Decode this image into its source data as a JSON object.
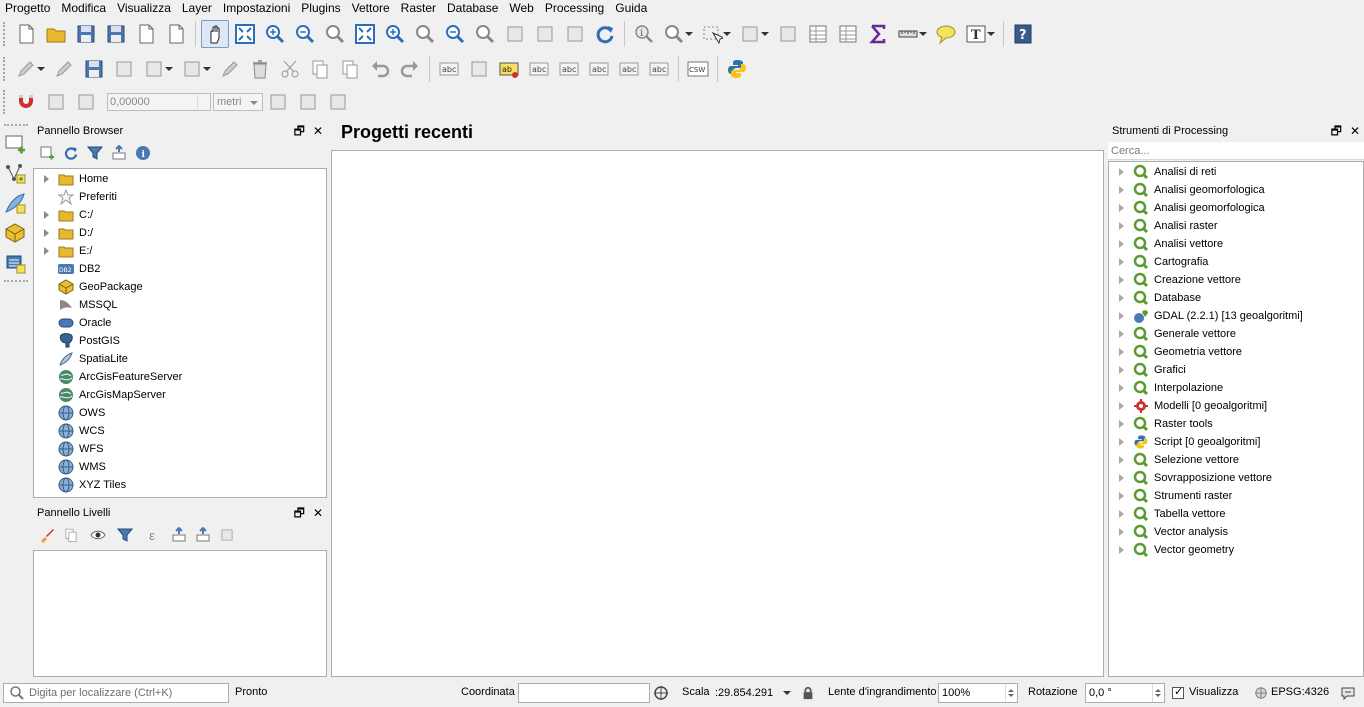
{
  "menu": [
    "Progetto",
    "Modifica",
    "Visualizza",
    "Layer",
    "Impostazioni",
    "Plugins",
    "Vettore",
    "Raster",
    "Database",
    "Web",
    "Processing",
    "Guida"
  ],
  "snapping": {
    "tolerance": "0,00000",
    "unit": "metri"
  },
  "browser_panel": {
    "title": "Pannello Browser",
    "items": [
      {
        "label": "Home",
        "icon": "folder-icon",
        "expandable": true
      },
      {
        "label": "Preferiti",
        "icon": "star-icon",
        "expandable": false
      },
      {
        "label": "C:/",
        "icon": "folder-icon",
        "expandable": true
      },
      {
        "label": "D:/",
        "icon": "folder-icon",
        "expandable": true
      },
      {
        "label": "E:/",
        "icon": "folder-icon",
        "expandable": true
      },
      {
        "label": "DB2",
        "icon": "db2-icon",
        "expandable": false
      },
      {
        "label": "GeoPackage",
        "icon": "geopackage-icon",
        "expandable": false
      },
      {
        "label": "MSSQL",
        "icon": "mssql-icon",
        "expandable": false
      },
      {
        "label": "Oracle",
        "icon": "oracle-icon",
        "expandable": false
      },
      {
        "label": "PostGIS",
        "icon": "postgis-icon",
        "expandable": false
      },
      {
        "label": "SpatiaLite",
        "icon": "spatialite-icon",
        "expandable": false
      },
      {
        "label": "ArcGisFeatureServer",
        "icon": "arcgis-icon",
        "expandable": false
      },
      {
        "label": "ArcGisMapServer",
        "icon": "arcgis-icon",
        "expandable": false
      },
      {
        "label": "OWS",
        "icon": "globe-icon",
        "expandable": false
      },
      {
        "label": "WCS",
        "icon": "globe-icon",
        "expandable": false
      },
      {
        "label": "WFS",
        "icon": "globe-icon",
        "expandable": false
      },
      {
        "label": "WMS",
        "icon": "globe-icon",
        "expandable": false
      },
      {
        "label": "XYZ Tiles",
        "icon": "globe-icon",
        "expandable": false
      }
    ]
  },
  "layers_panel": {
    "title": "Pannello Livelli"
  },
  "center": {
    "title": "Progetti recenti"
  },
  "processing_panel": {
    "title": "Strumenti di Processing",
    "search_placeholder": "Cerca...",
    "items": [
      {
        "label": "Analisi di reti",
        "icon": "qgis-icon"
      },
      {
        "label": "Analisi geomorfologica",
        "icon": "qgis-icon"
      },
      {
        "label": "Analisi geomorfologica",
        "icon": "qgis-icon"
      },
      {
        "label": "Analisi raster",
        "icon": "qgis-icon"
      },
      {
        "label": "Analisi vettore",
        "icon": "qgis-icon"
      },
      {
        "label": "Cartografia",
        "icon": "qgis-icon"
      },
      {
        "label": "Creazione vettore",
        "icon": "qgis-icon"
      },
      {
        "label": "Database",
        "icon": "qgis-icon"
      },
      {
        "label": "GDAL (2.2.1) [13 geoalgoritmi]",
        "icon": "gdal-icon"
      },
      {
        "label": "Generale vettore",
        "icon": "qgis-icon"
      },
      {
        "label": "Geometria vettore",
        "icon": "qgis-icon"
      },
      {
        "label": "Grafici",
        "icon": "qgis-icon"
      },
      {
        "label": "Interpolazione",
        "icon": "qgis-icon"
      },
      {
        "label": "Modelli [0 geoalgoritmi]",
        "icon": "model-icon"
      },
      {
        "label": "Raster tools",
        "icon": "qgis-icon"
      },
      {
        "label": "Script [0 geoalgoritmi]",
        "icon": "python-icon"
      },
      {
        "label": "Selezione vettore",
        "icon": "qgis-icon"
      },
      {
        "label": "Sovrapposizione vettore",
        "icon": "qgis-icon"
      },
      {
        "label": "Strumenti raster",
        "icon": "qgis-icon"
      },
      {
        "label": "Tabella vettore",
        "icon": "qgis-icon"
      },
      {
        "label": "Vector analysis",
        "icon": "qgis-icon"
      },
      {
        "label": "Vector geometry",
        "icon": "qgis-icon"
      }
    ]
  },
  "statusbar": {
    "search_placeholder": "Digita per localizzare (Ctrl+K)",
    "status": "Pronto",
    "coord_label": "Coordinata",
    "coord_value": "",
    "scale_label": "Scala",
    "scale_value": ":29.854.291",
    "magnifier_label": "Lente d'ingrandimento",
    "magnifier_value": "100%",
    "rotation_label": "Rotazione",
    "rotation_value": "0,0 °",
    "render_label": "Visualizza",
    "crs": "EPSG:4326"
  },
  "colors": {
    "qgis_green": "#5a9a2e",
    "folder_yellow": "#e8b830",
    "accent_blue": "#2c6fb8"
  }
}
